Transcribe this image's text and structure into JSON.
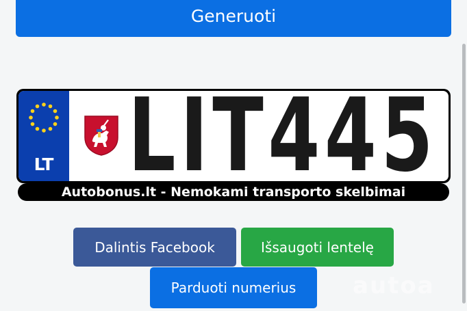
{
  "generate_button": {
    "label": "Generuoti"
  },
  "plate": {
    "country_code": "LT",
    "number": "LIT445",
    "caption": "Autobonus.lt - Nemokami transporto skelbimai",
    "eu_band_color": "#0b3fae",
    "coat_of_arms": "lithuanian-vytis-emblem"
  },
  "actions": {
    "share_facebook": "Dalintis Facebook",
    "save_plate": "Išsaugoti lentelę",
    "sell_numbers": "Parduoti numerius"
  },
  "colors": {
    "primary": "#0b6fe3",
    "facebook": "#3b5998",
    "success": "#28a745"
  },
  "watermark": "autoa"
}
